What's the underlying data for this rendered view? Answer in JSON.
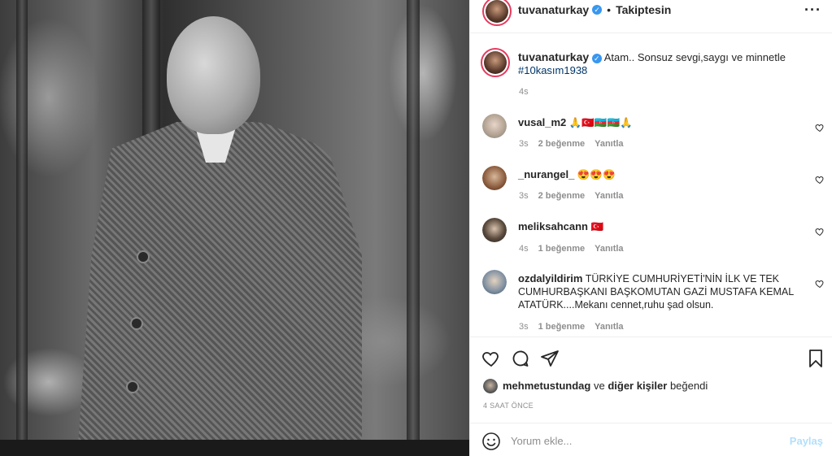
{
  "post": {
    "author": "tuvanaturkay",
    "verified_badge": "✓",
    "separator": "•",
    "follow_status": "Takiptesin",
    "more_label": "···",
    "caption_text": "Atam.. Sonsuz sevgi,saygı ve minnetle",
    "caption_hashtag": "#10kasım1938",
    "caption_time": "4s",
    "photo_icon": "old-photo-portrait"
  },
  "comments": [
    {
      "user": "vusal_m2",
      "text": "🙏🇹🇷🇦🇿🇦🇿🙏",
      "time": "3s",
      "likes": "2 beğenme",
      "reply": "Yanıtla"
    },
    {
      "user": "_nurangel_",
      "text": "😍😍😍",
      "time": "3s",
      "likes": "2 beğenme",
      "reply": "Yanıtla"
    },
    {
      "user": "meliksahcann",
      "text": "🇹🇷",
      "time": "4s",
      "likes": "1 beğenme",
      "reply": "Yanıtla"
    },
    {
      "user": "ozdalyildirim",
      "text": "TÜRKİYE CUMHURİYETİ'NİN İLK VE TEK CUMHURBAŞKANI BAŞKOMUTAN GAZİ MUSTAFA KEMAL ATATÜRK....Mekanı cennet,ruhu şad olsun.",
      "time": "3s",
      "likes": "1 beğenme",
      "reply": "Yanıtla"
    }
  ],
  "likes": {
    "user": "mehmetustundag",
    "conj": "ve",
    "others": "diğer kişiler",
    "suffix": "beğendi"
  },
  "timestamp": "4 SAAT ÖNCE",
  "add_comment": {
    "placeholder": "Yorum ekle...",
    "post_label": "Paylaş"
  },
  "colors": {
    "accent_ring": "#e63a5e",
    "verified": "#3897f0",
    "hashtag": "#00376b",
    "post_disabled": "#b2dffc"
  }
}
